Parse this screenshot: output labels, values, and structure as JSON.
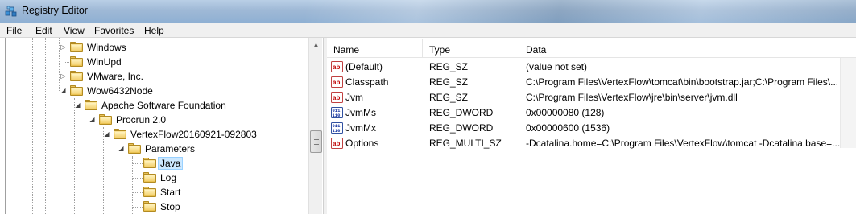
{
  "window": {
    "title": "Registry Editor"
  },
  "menu": [
    "File",
    "Edit",
    "View",
    "Favorites",
    "Help"
  ],
  "tree": {
    "nodes": [
      {
        "label": "Windows",
        "expander": "right"
      },
      {
        "label": "WinUpd",
        "expander": ""
      },
      {
        "label": "VMware, Inc.",
        "expander": "right"
      },
      {
        "label": "Wow6432Node",
        "expander": "down"
      },
      {
        "label": "Apache Software Foundation",
        "expander": "down"
      },
      {
        "label": "Procrun 2.0",
        "expander": "down"
      },
      {
        "label": "VertexFlow20160921-092803",
        "expander": "down"
      },
      {
        "label": "Parameters",
        "expander": "down"
      },
      {
        "label": "Java",
        "expander": "",
        "selected": true
      },
      {
        "label": "Log",
        "expander": ""
      },
      {
        "label": "Start",
        "expander": ""
      },
      {
        "label": "Stop",
        "expander": ""
      }
    ]
  },
  "values": {
    "columns": {
      "name": "Name",
      "type": "Type",
      "data": "Data"
    },
    "rows": [
      {
        "name": "(Default)",
        "type": "REG_SZ",
        "data": "(value not set)",
        "icon": "string-value-icon"
      },
      {
        "name": "Classpath",
        "type": "REG_SZ",
        "data": "C:\\Program Files\\VertexFlow\\tomcat\\bin\\bootstrap.jar;C:\\Program Files\\...",
        "icon": "string-value-icon"
      },
      {
        "name": "Jvm",
        "type": "REG_SZ",
        "data": "C:\\Program Files\\VertexFlow\\jre\\bin\\server\\jvm.dll",
        "icon": "string-value-icon"
      },
      {
        "name": "JvmMs",
        "type": "REG_DWORD",
        "data": "0x00000080 (128)",
        "icon": "binary-value-icon"
      },
      {
        "name": "JvmMx",
        "type": "REG_DWORD",
        "data": "0x00000600 (1536)",
        "icon": "binary-value-icon"
      },
      {
        "name": "Options",
        "type": "REG_MULTI_SZ",
        "data": "-Dcatalina.home=C:\\Program Files\\VertexFlow\\tomcat -Dcatalina.base=...",
        "icon": "string-value-icon"
      }
    ]
  },
  "colors": {
    "selection": "#cce8ff",
    "selection_border": "#99d1ff",
    "titlebar": "#9fb9d6"
  }
}
